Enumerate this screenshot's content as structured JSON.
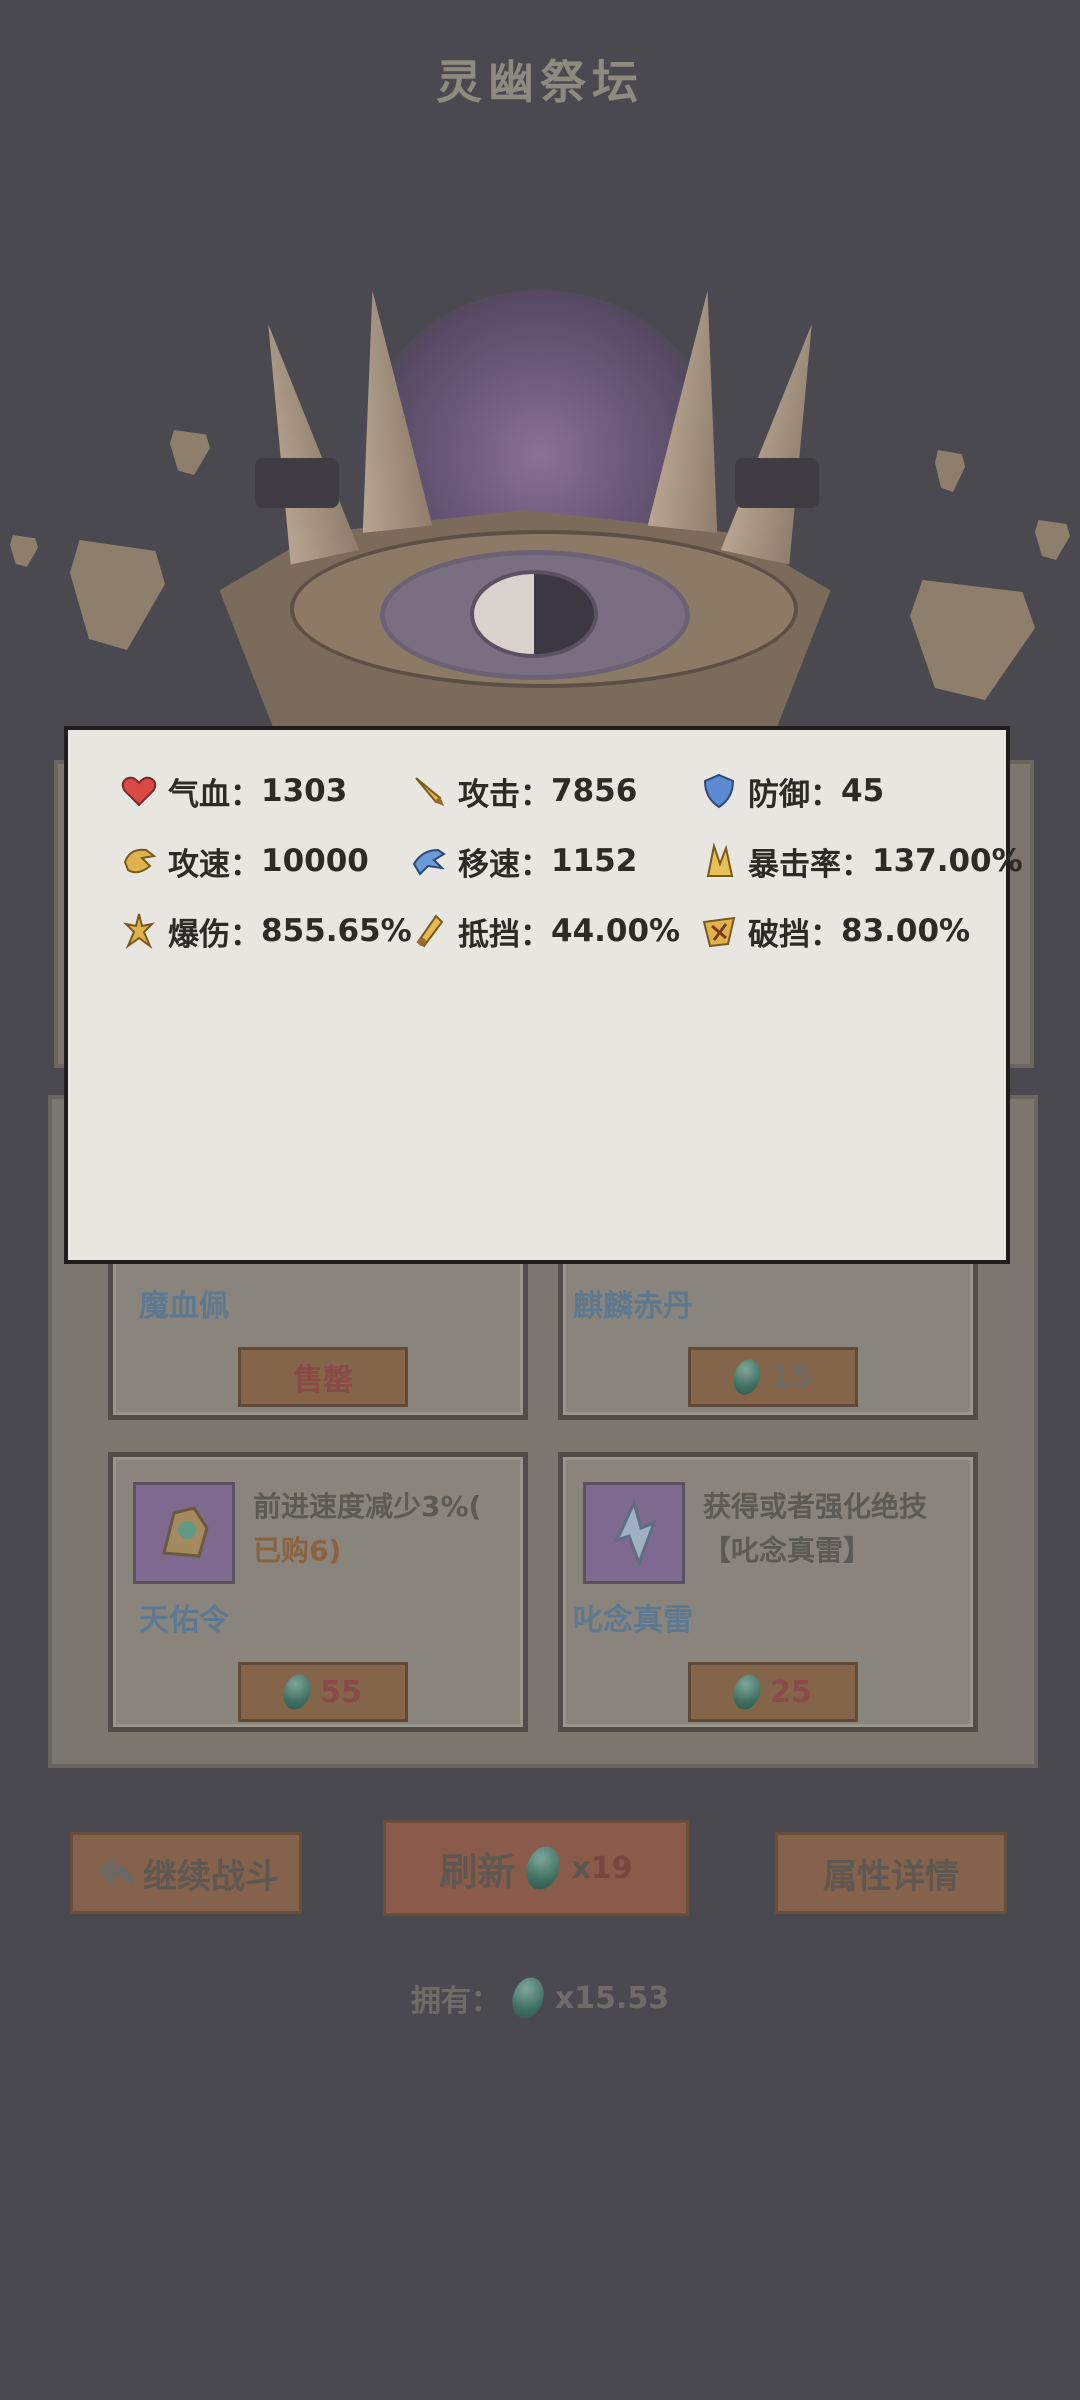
{
  "header": {
    "title": "灵幽祭坛"
  },
  "popup": {
    "stats": [
      {
        "icon": "heart-icon",
        "label": "气血：",
        "value": "1303"
      },
      {
        "icon": "sword-icon",
        "label": "攻击：",
        "value": "7856"
      },
      {
        "icon": "shield-icon",
        "label": "防御：",
        "value": "45"
      },
      {
        "icon": "attack-speed-icon",
        "label": "攻速：",
        "value": "10000"
      },
      {
        "icon": "move-speed-icon",
        "label": "移速：",
        "value": "1152"
      },
      {
        "icon": "crit-rate-icon",
        "label": "暴击率：",
        "value": "137.00%"
      },
      {
        "icon": "crit-damage-icon",
        "label": "爆伤：",
        "value": "855.65%"
      },
      {
        "icon": "block-icon",
        "label": "抵挡：",
        "value": "44.00%"
      },
      {
        "icon": "break-block-icon",
        "label": "破挡：",
        "value": "83.00%"
      }
    ]
  },
  "shop": {
    "cards": [
      {
        "name": "魔血佩",
        "price_label": "售罄",
        "price": null
      },
      {
        "name": "麒麟赤丹",
        "price_label": null,
        "price": "15"
      },
      {
        "name": "天佑令",
        "desc": "前进速度减少3%(",
        "desc_sub": "已购6)",
        "price": "55",
        "icon": "dragon-token-icon"
      },
      {
        "name": "叱念真雷",
        "desc": "获得或者强化绝技",
        "desc_sub": "【叱念真雷】",
        "price": "25",
        "icon": "lightning-crystal-icon"
      }
    ]
  },
  "controls": {
    "continue_label": "继续战斗",
    "refresh_label": "刷新",
    "refresh_cost_prefix": "x",
    "refresh_cost": "19",
    "details_label": "属性详情",
    "owned_label": "拥有：",
    "owned_value": "x15.53"
  },
  "colors": {
    "popup_bg": "#e7e6e1",
    "overlay_bg": "#4b4950",
    "button": "#84624b"
  }
}
